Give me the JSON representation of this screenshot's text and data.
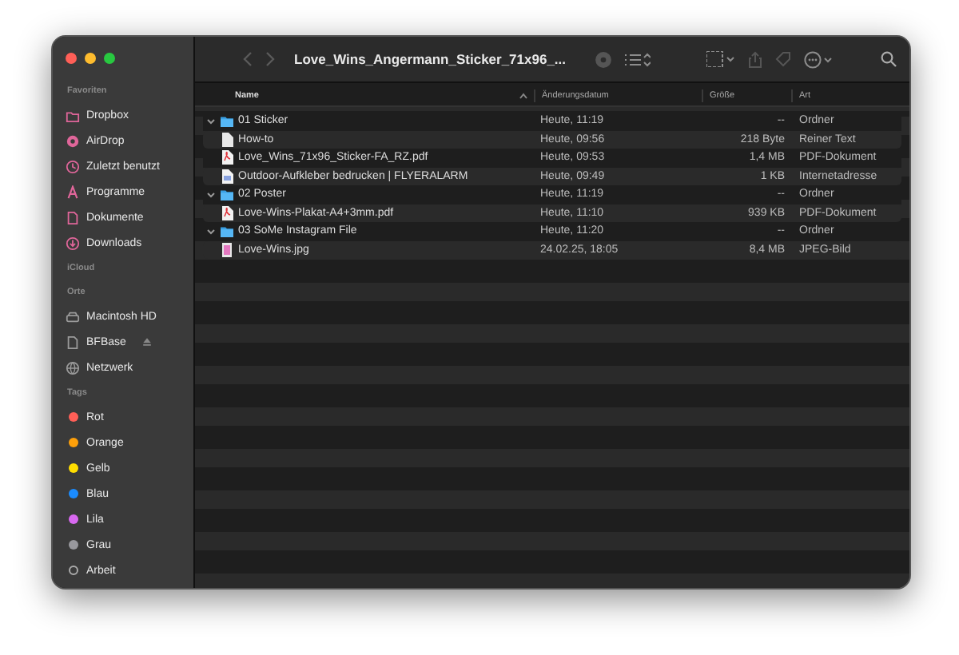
{
  "window": {
    "title": "Love_Wins_Angermann_Sticker_71x96_..."
  },
  "sidebar": {
    "sections": [
      {
        "header": "Favoriten",
        "items": [
          {
            "label": "Dropbox",
            "selected": false
          },
          {
            "label": "AirDrop",
            "selected": false
          },
          {
            "label": "Zuletzt benutzt",
            "selected": false
          },
          {
            "label": "Programme",
            "selected": false
          },
          {
            "label": "Dokumente",
            "selected": false
          },
          {
            "label": "Downloads",
            "selected": false
          }
        ]
      },
      {
        "header": "iCloud"
      },
      {
        "header": "Orte",
        "items": [
          {
            "label": "Macintosh HD",
            "selected": false,
            "ejectable": false
          },
          {
            "label": "BFBase",
            "selected": false,
            "ejectable": true
          },
          {
            "label": "Netzwerk",
            "selected": false,
            "ejectable": false
          }
        ]
      },
      {
        "header": "Tags",
        "items": [
          {
            "label": "Rot",
            "color": "#ff5f57"
          },
          {
            "label": "Orange",
            "color": "#fea00a"
          },
          {
            "label": "Gelb",
            "color": "#ffdd00"
          },
          {
            "label": "Blau",
            "color": "#1b8cff"
          },
          {
            "label": "Lila",
            "color": "#d868f0"
          },
          {
            "label": "Grau",
            "color": "#98989d"
          },
          {
            "label": "Arbeit"
          }
        ]
      }
    ]
  },
  "table": {
    "columns": [
      {
        "label": "Name",
        "sorted": true
      },
      {
        "label": "Änderungsdatum",
        "sorted": false
      },
      {
        "label": "Größe",
        "sorted": false
      },
      {
        "label": "Art",
        "sorted": false
      }
    ],
    "rows": [
      {
        "kind": "folder",
        "name": "01 Sticker",
        "date": "Heute, 11:19",
        "size": "--",
        "type": "Ordner",
        "expanded": true,
        "children": [
          {
            "kind": "text",
            "name": "How-to",
            "date": "Heute, 09:56",
            "size": "218 Byte",
            "type": "Reiner Text"
          },
          {
            "kind": "pdf",
            "name": "Love_Wins_71x96_Sticker-FA_RZ.pdf",
            "date": "Heute, 09:53",
            "size": "1,4 MB",
            "type": "PDF-Dokument"
          },
          {
            "kind": "link",
            "name": "Outdoor-Aufkleber bedrucken | FLYERALARM",
            "date": "Heute, 09:49",
            "size": "1 KB",
            "type": "Internetadresse"
          }
        ]
      },
      {
        "kind": "folder",
        "name": "02 Poster",
        "date": "Heute, 11:19",
        "size": "--",
        "type": "Ordner",
        "expanded": true,
        "children": [
          {
            "kind": "pdf",
            "name": "Love-Wins-Plakat-A4+3mm.pdf",
            "date": "Heute, 11:10",
            "size": "939 KB",
            "type": "PDF-Dokument"
          }
        ]
      },
      {
        "kind": "folder",
        "name": "03 SoMe Instagram File",
        "date": "Heute, 11:20",
        "size": "--",
        "type": "Ordner",
        "expanded": true,
        "children": [
          {
            "kind": "image",
            "name": "Love-Wins.jpg",
            "date": "24.02.25, 18:05",
            "size": "8,4 MB",
            "type": "JPEG-Bild"
          }
        ]
      }
    ]
  }
}
